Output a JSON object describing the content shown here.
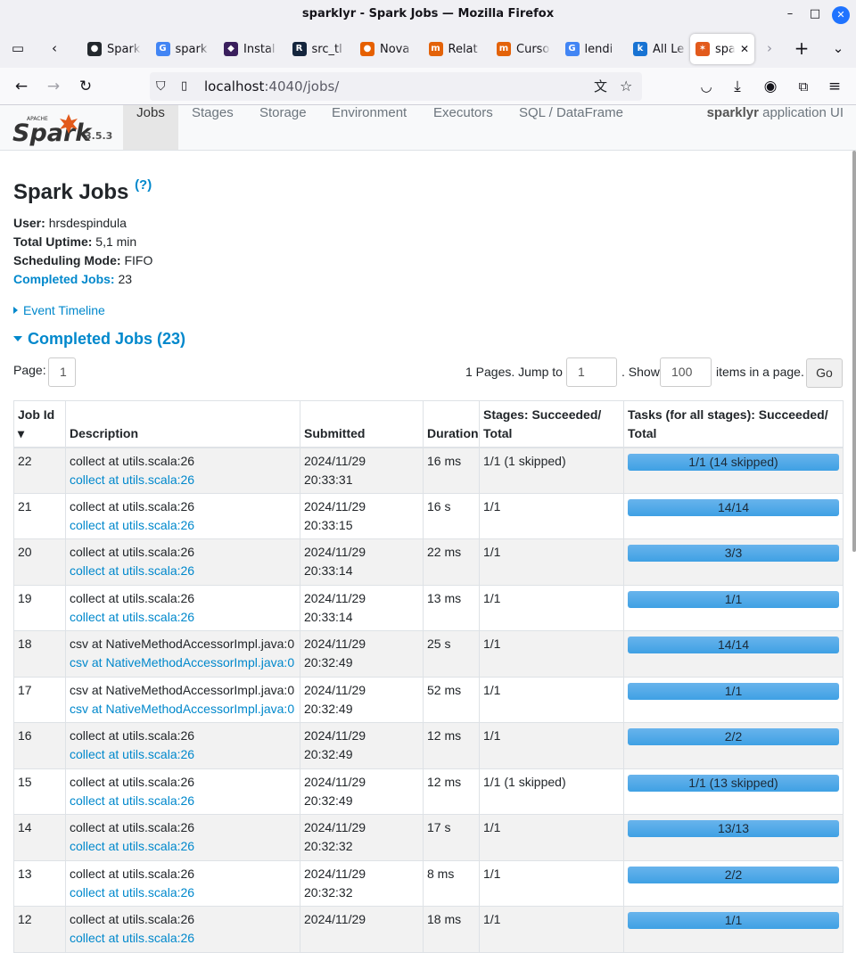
{
  "window": {
    "title": "sparklyr - Spark Jobs — Mozilla Firefox",
    "controls": [
      "–",
      "□",
      "✕"
    ]
  },
  "tabs": [
    {
      "icon": "github-icon",
      "label": "Spark",
      "color": "#24292e",
      "glyph": "●"
    },
    {
      "icon": "google-icon",
      "label": "spark",
      "color": "#4285f4",
      "glyph": "G"
    },
    {
      "icon": "install-icon",
      "label": "Instal",
      "color": "#3a1f5d",
      "glyph": "◆"
    },
    {
      "icon": "r-icon",
      "label": "src_tl",
      "color": "#14253d",
      "glyph": "R"
    },
    {
      "icon": "firefox-icon",
      "label": "Nova",
      "color": "#e66000",
      "glyph": "●"
    },
    {
      "icon": "medium-icon",
      "label": "Relat",
      "color": "#e36209",
      "glyph": "m"
    },
    {
      "icon": "medium-icon",
      "label": "Curso",
      "color": "#e36209",
      "glyph": "m"
    },
    {
      "icon": "google-icon",
      "label": "lendi",
      "color": "#4285f4",
      "glyph": "G"
    },
    {
      "icon": "k-icon",
      "label": "All Le",
      "color": "#1873d3",
      "glyph": "k"
    },
    {
      "icon": "spark-icon",
      "label": "spa",
      "color": "#e25a1c",
      "glyph": "✶",
      "active": true
    }
  ],
  "nav": {
    "url_host": "localhost",
    "url_rest": ":4040/jobs/"
  },
  "spark": {
    "logo_text": "Spark",
    "logo_super": "APACHE",
    "version": "3.5.3",
    "nav_items": [
      "Jobs",
      "Stages",
      "Storage",
      "Environment",
      "Executors",
      "SQL / DataFrame"
    ],
    "app_name_bold": "sparklyr",
    "app_name_rest": " application UI"
  },
  "page": {
    "title": "Spark Jobs",
    "help": "(?)",
    "user_label": "User:",
    "user": "hrsdespindula",
    "uptime_label": "Total Uptime:",
    "uptime": "5,1 min",
    "sched_label": "Scheduling Mode:",
    "sched": "FIFO",
    "completed_label": "Completed Jobs:",
    "completed": "23",
    "event_timeline": "Event Timeline",
    "section": "Completed Jobs (23)",
    "page_label": "Page:",
    "page_value": "1",
    "pages_text": "1 Pages. Jump to",
    "jump_value": "1",
    "show_text": ". Show",
    "show_value": "100",
    "items_text": "items in a page.",
    "go": "Go"
  },
  "table": {
    "headers": [
      "Job Id ▾",
      "Description",
      "Submitted",
      "Duration",
      "Stages: Succeeded/ Total",
      "Tasks (for all stages): Succeeded/ Total"
    ],
    "rows": [
      {
        "id": "22",
        "desc": "collect at utils.scala:26",
        "link": "collect at utils.scala:26",
        "date": "2024/11/29",
        "time": "20:33:31",
        "dur": "16 ms",
        "stages": "1/1 (1 skipped)",
        "tasks": "1/1 (14 skipped)",
        "progress": 1.0
      },
      {
        "id": "21",
        "desc": "collect at utils.scala:26",
        "link": "collect at utils.scala:26",
        "date": "2024/11/29",
        "time": "20:33:15",
        "dur": "16 s",
        "stages": "1/1",
        "tasks": "14/14",
        "progress": 1.0
      },
      {
        "id": "20",
        "desc": "collect at utils.scala:26",
        "link": "collect at utils.scala:26",
        "date": "2024/11/29",
        "time": "20:33:14",
        "dur": "22 ms",
        "stages": "1/1",
        "tasks": "3/3",
        "progress": 1.0
      },
      {
        "id": "19",
        "desc": "collect at utils.scala:26",
        "link": "collect at utils.scala:26",
        "date": "2024/11/29",
        "time": "20:33:14",
        "dur": "13 ms",
        "stages": "1/1",
        "tasks": "1/1",
        "progress": 1.0
      },
      {
        "id": "18",
        "desc": "csv at NativeMethodAccessorImpl.java:0",
        "link": "csv at NativeMethodAccessorImpl.java:0",
        "date": "2024/11/29",
        "time": "20:32:49",
        "dur": "25 s",
        "stages": "1/1",
        "tasks": "14/14",
        "progress": 1.0
      },
      {
        "id": "17",
        "desc": "csv at NativeMethodAccessorImpl.java:0",
        "link": "csv at NativeMethodAccessorImpl.java:0",
        "date": "2024/11/29",
        "time": "20:32:49",
        "dur": "52 ms",
        "stages": "1/1",
        "tasks": "1/1",
        "progress": 1.0
      },
      {
        "id": "16",
        "desc": "collect at utils.scala:26",
        "link": "collect at utils.scala:26",
        "date": "2024/11/29",
        "time": "20:32:49",
        "dur": "12 ms",
        "stages": "1/1",
        "tasks": "2/2",
        "progress": 1.0
      },
      {
        "id": "15",
        "desc": "collect at utils.scala:26",
        "link": "collect at utils.scala:26",
        "date": "2024/11/29",
        "time": "20:32:49",
        "dur": "12 ms",
        "stages": "1/1 (1 skipped)",
        "tasks": "1/1 (13 skipped)",
        "progress": 1.0
      },
      {
        "id": "14",
        "desc": "collect at utils.scala:26",
        "link": "collect at utils.scala:26",
        "date": "2024/11/29",
        "time": "20:32:32",
        "dur": "17 s",
        "stages": "1/1",
        "tasks": "13/13",
        "progress": 1.0
      },
      {
        "id": "13",
        "desc": "collect at utils.scala:26",
        "link": "collect at utils.scala:26",
        "date": "2024/11/29",
        "time": "20:32:32",
        "dur": "8 ms",
        "stages": "1/1",
        "tasks": "2/2",
        "progress": 1.0
      },
      {
        "id": "12",
        "desc": "collect at utils.scala:26",
        "link": "collect at utils.scala:26",
        "date": "2024/11/29",
        "time": "",
        "dur": "18 ms",
        "stages": "1/1",
        "tasks": "1/1",
        "progress": 1.0
      }
    ]
  },
  "colors": {
    "accent": "#0088cc",
    "bar": "#3fa1e4",
    "spark_orange": "#e25a1c"
  }
}
